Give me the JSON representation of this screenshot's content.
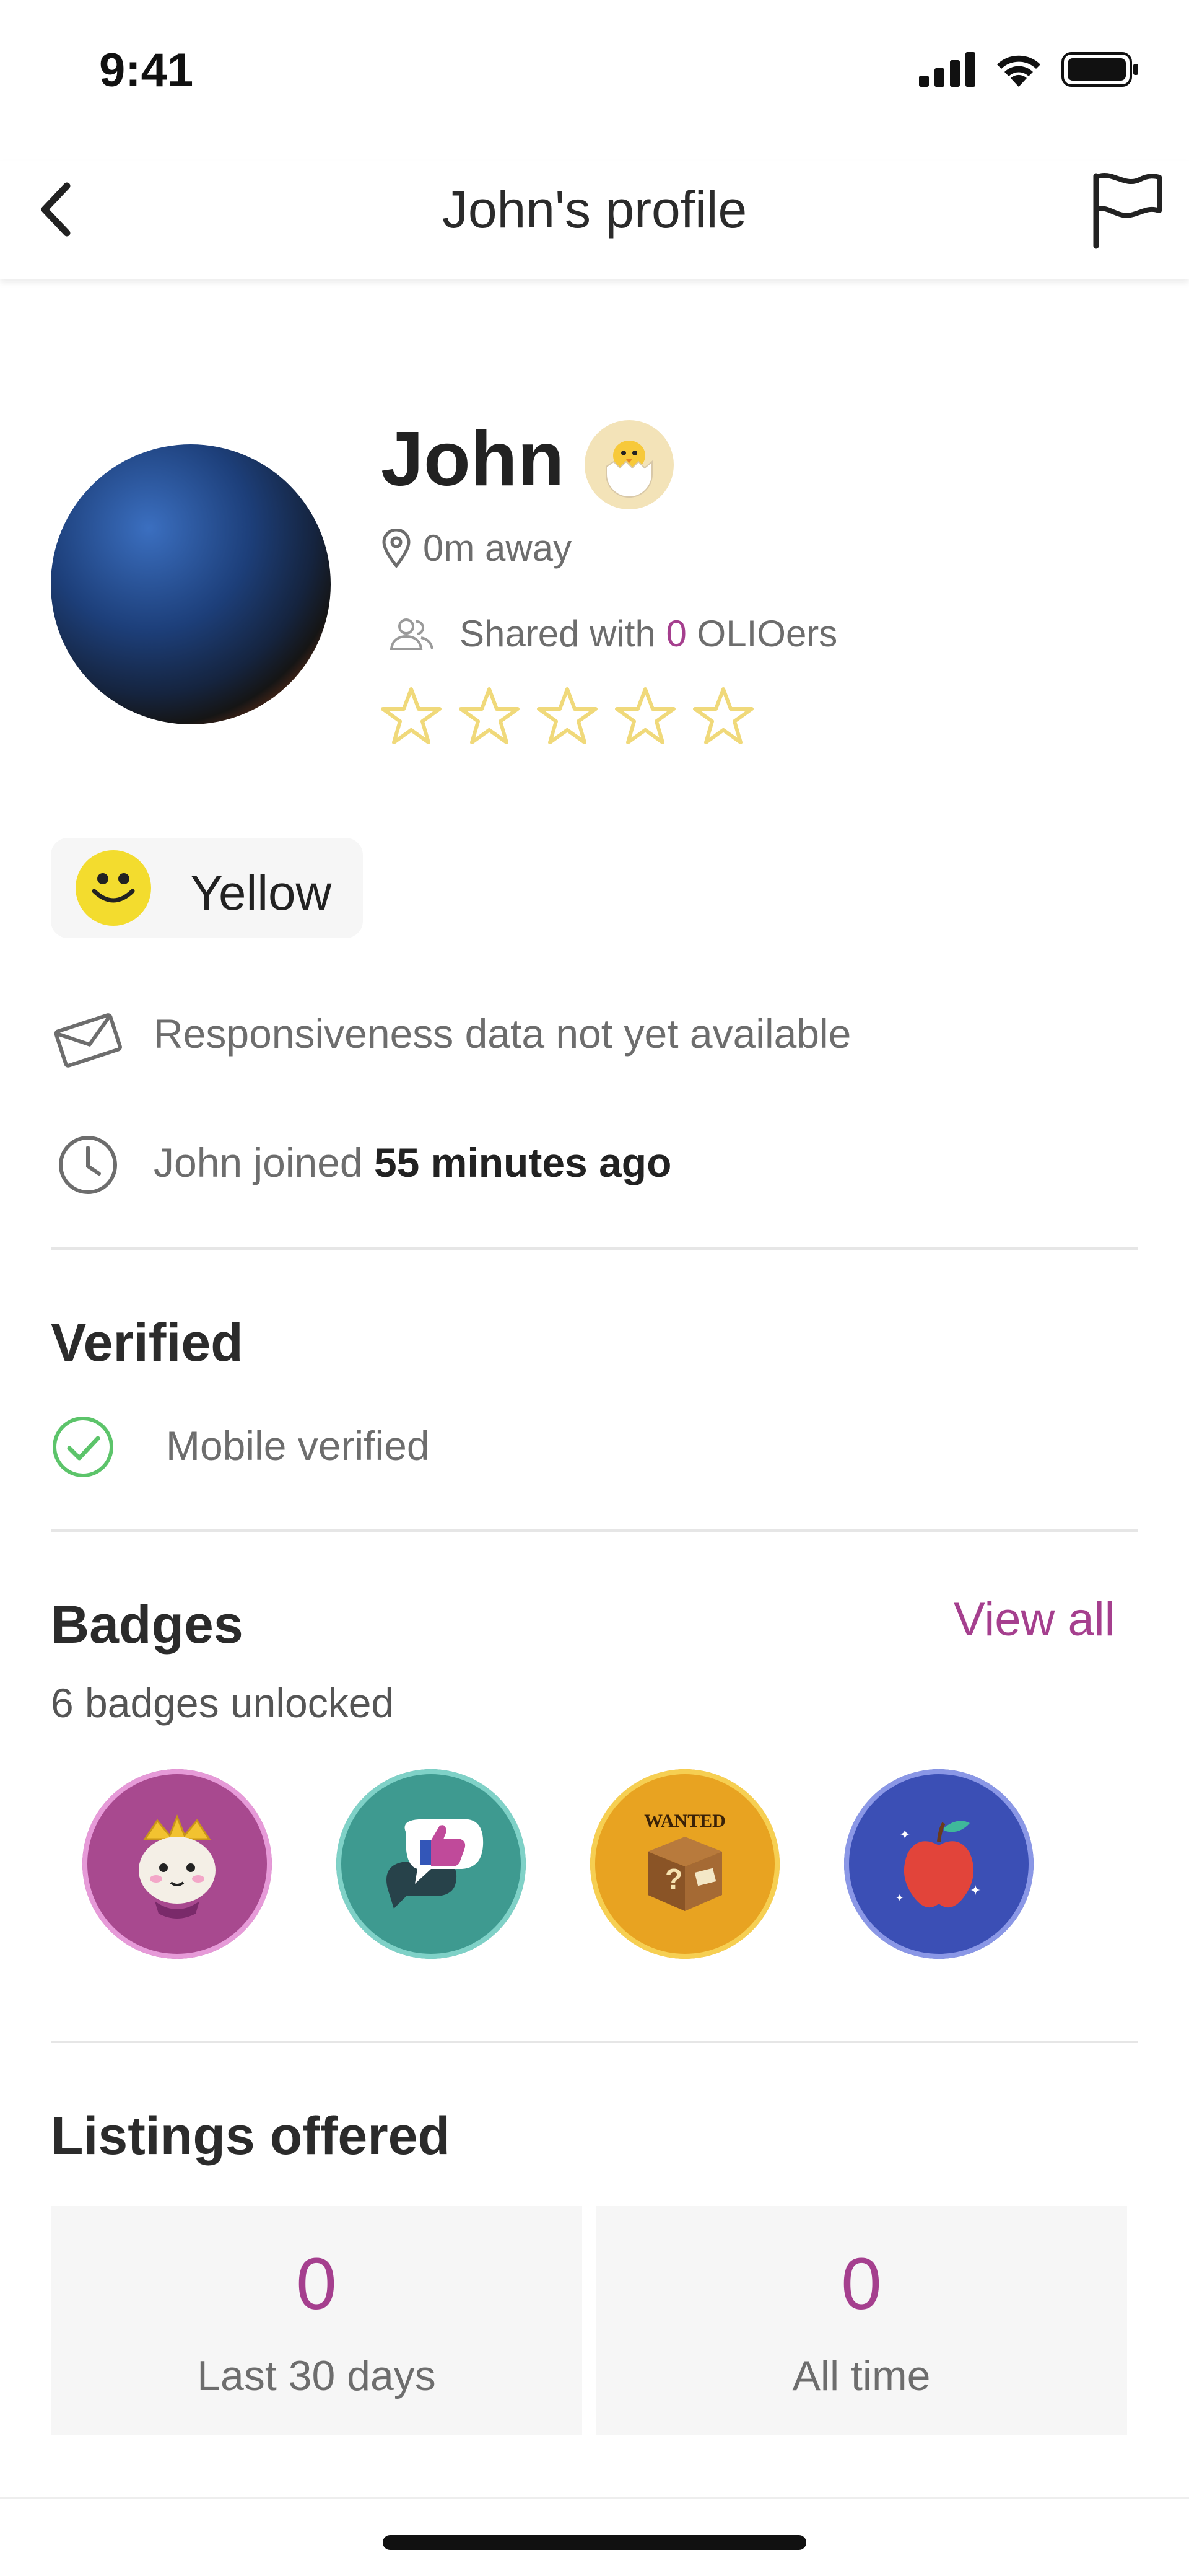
{
  "status": {
    "time": "9:41"
  },
  "nav": {
    "title": "John's profile"
  },
  "profile": {
    "name": "John",
    "distance": "0m away",
    "shared_prefix": "Shared with ",
    "shared_count": "0",
    "shared_suffix": " OLIOers",
    "rating_stars": 0,
    "rating_max": 5
  },
  "level": {
    "label": "Yellow"
  },
  "info": {
    "responsiveness": "Responsiveness data not yet available",
    "joined_prefix": "John joined ",
    "joined_time": "55 minutes ago"
  },
  "verified": {
    "title": "Verified",
    "items": [
      "Mobile verified"
    ]
  },
  "badges": {
    "title": "Badges",
    "view_all": "View all",
    "count_text": "6 badges unlocked",
    "items": [
      {
        "icon": "crown-badge-icon",
        "color": "#a8498f",
        "ring": "#e69ad8"
      },
      {
        "icon": "thumbs-up-badge-icon",
        "color": "#3e9a90",
        "ring": "#7fd1c7"
      },
      {
        "icon": "wanted-box-badge-icon",
        "color": "#e8a321",
        "ring": "#f6cf52",
        "text": "WANTED"
      },
      {
        "icon": "apple-badge-icon",
        "color": "#3b4fb5",
        "ring": "#8a97e6"
      }
    ]
  },
  "listings": {
    "title": "Listings offered",
    "stats": [
      {
        "value": "0",
        "label": "Last 30 days"
      },
      {
        "value": "0",
        "label": "All time"
      }
    ]
  },
  "colors": {
    "accent": "#a53f8e",
    "success": "#5cc46a",
    "star": "#f0d97a"
  }
}
